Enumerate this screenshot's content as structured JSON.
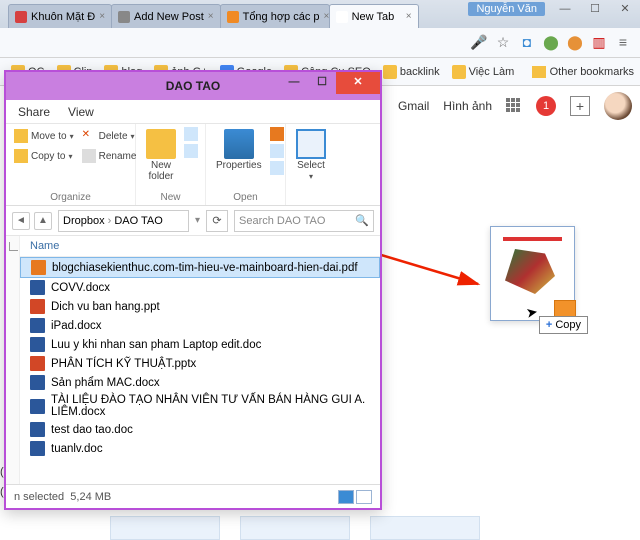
{
  "browser": {
    "user": "Nguyễn Văn",
    "tabs": [
      {
        "label": "Khuôn Mặt Đ",
        "favicon": "#d64040"
      },
      {
        "label": "Add New Post",
        "favicon": "#888888"
      },
      {
        "label": "Tổng hợp các p",
        "favicon": "#f08a24"
      },
      {
        "label": "New Tab",
        "favicon": "#ffffff",
        "active": true
      }
    ],
    "bookmarks": [
      {
        "label": "QC",
        "color": "#f5c043"
      },
      {
        "label": "Clip",
        "color": "#f5c043"
      },
      {
        "label": "blog",
        "color": "#f5c043"
      },
      {
        "label": "ảnh G+",
        "color": "#f5c043"
      },
      {
        "label": "Google",
        "color": "#4285f4"
      },
      {
        "label": "Công Cụ SEO",
        "color": "#f5c043"
      },
      {
        "label": "backlink",
        "color": "#f5c043"
      },
      {
        "label": "Việc Làm",
        "color": "#f5c043"
      }
    ],
    "other_bookmarks": "Other bookmarks"
  },
  "google_top": {
    "gmail": "Gmail",
    "images": "Hình ảnh",
    "notif_count": "1"
  },
  "drag": {
    "copy_label": "Copy"
  },
  "explorer": {
    "title": "DAO TAO",
    "menu": {
      "share": "Share",
      "view": "View"
    },
    "ribbon": {
      "move_to": "Move to",
      "copy_to": "Copy to",
      "delete": "Delete",
      "rename": "Rename",
      "organize": "Organize",
      "new_folder": "New\nfolder",
      "new": "New",
      "properties": "Properties",
      "open": "Open",
      "select": "Select"
    },
    "path": [
      "Dropbox",
      "DAO TAO"
    ],
    "search_placeholder": "Search DAO TAO",
    "column_header": "Name",
    "files": [
      {
        "name": "blogchiasekienthuc.com-tim-hieu-ve-mainboard-hien-dai.pdf",
        "type": "pdf",
        "selected": true
      },
      {
        "name": "COVV.docx",
        "type": "docx"
      },
      {
        "name": "Dich vu ban hang.ppt",
        "type": "ppt"
      },
      {
        "name": "iPad.docx",
        "type": "docx"
      },
      {
        "name": "Luu y khi nhan san pham Laptop edit.doc",
        "type": "doc"
      },
      {
        "name": "PHÂN TÍCH KỸ THUẬT.pptx",
        "type": "ppt"
      },
      {
        "name": "Sản phẩm MAC.docx",
        "type": "docx"
      },
      {
        "name": "TÀI LIỆU ĐÀO TẠO NHÂN VIÊN TƯ VẤN BÁN HÀNG GUI A. LIÊM.docx",
        "type": "docx"
      },
      {
        "name": "test dao tao.doc",
        "type": "doc"
      },
      {
        "name": "tuanlv.doc",
        "type": "doc"
      }
    ],
    "status_left": "n selected",
    "status_size": "5,24 MB",
    "drive_label": "(C:)",
    "drive_label2": "(D:)"
  }
}
